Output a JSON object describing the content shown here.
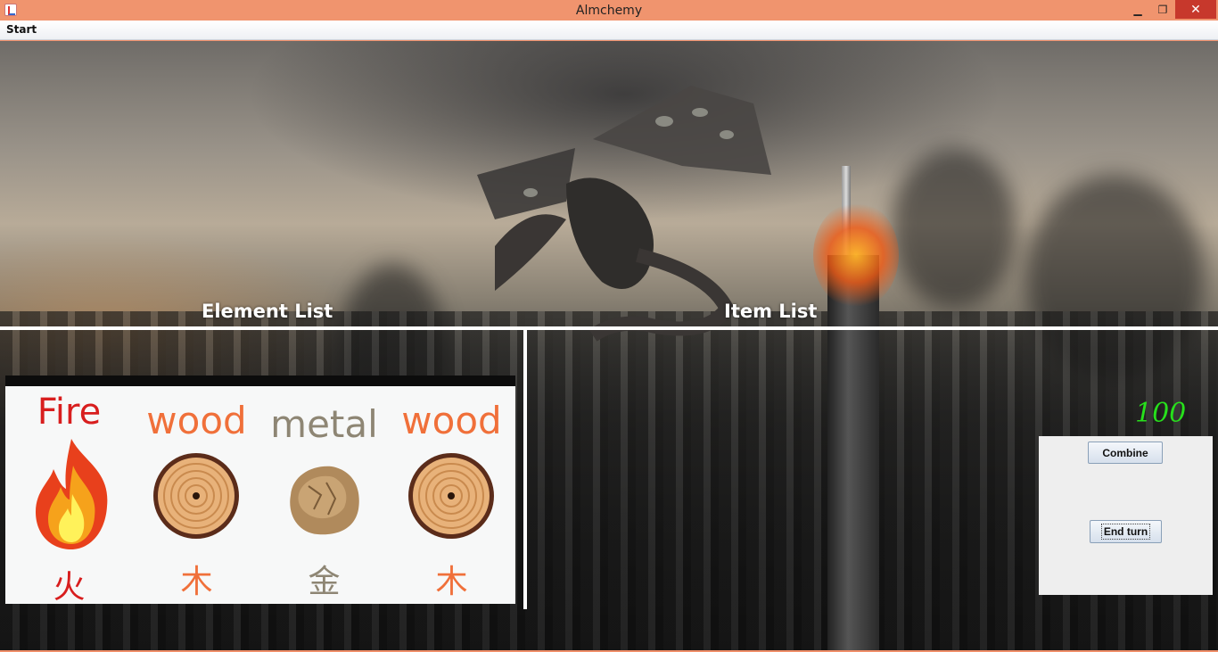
{
  "window": {
    "title": "Almchemy",
    "controls": {
      "minimize": "▁",
      "maximize": "❐",
      "close": "✕"
    }
  },
  "menu": {
    "start_label": "Start"
  },
  "labels": {
    "element_list": "Element List",
    "item_list": "Item List"
  },
  "elements": [
    {
      "name": "Fire",
      "glyph": "火",
      "icon": "fire-icon",
      "color": "#d81e1e"
    },
    {
      "name": "wood",
      "glyph": "木",
      "icon": "wood-log-icon",
      "color": "#f0703a"
    },
    {
      "name": "metal",
      "glyph": "金",
      "icon": "metal-ore-icon",
      "color": "#8e8674"
    },
    {
      "name": "wood",
      "glyph": "木",
      "icon": "wood-log-icon",
      "color": "#f0703a"
    }
  ],
  "score": "100",
  "actions": {
    "combine_label": "Combine",
    "end_turn_label": "End turn"
  },
  "colors": {
    "titlebar": "#f0946e",
    "score": "#27e01c",
    "close_button": "#c7382c"
  }
}
